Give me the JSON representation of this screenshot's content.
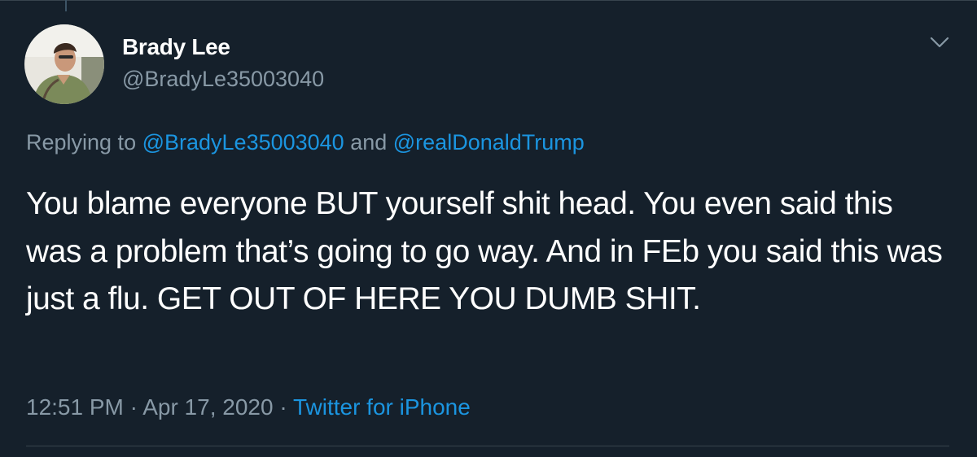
{
  "tweet": {
    "author": {
      "display_name": "Brady Lee",
      "handle": "@BradyLe35003040"
    },
    "reply": {
      "prefix": "Replying to ",
      "mention_1": "@BradyLe35003040",
      "joiner": " and ",
      "mention_2": "@realDonaldTrump"
    },
    "text": "You blame everyone BUT yourself shit head. You even said this was a problem that’s going to go way. And in FEb you said this was just a flu. GET OUT OF HERE YOU DUMB SHIT.",
    "meta": {
      "time": "12:51 PM",
      "separator_1": " · ",
      "date": "Apr 17, 2020",
      "separator_2": " · ",
      "source": "Twitter for iPhone"
    },
    "icons": {
      "menu": "chevron-down-icon"
    }
  },
  "colors": {
    "background": "#15202b",
    "text_primary": "#ffffff",
    "text_secondary": "#8899a6",
    "accent": "#1b95e0",
    "divider": "#38444d"
  }
}
